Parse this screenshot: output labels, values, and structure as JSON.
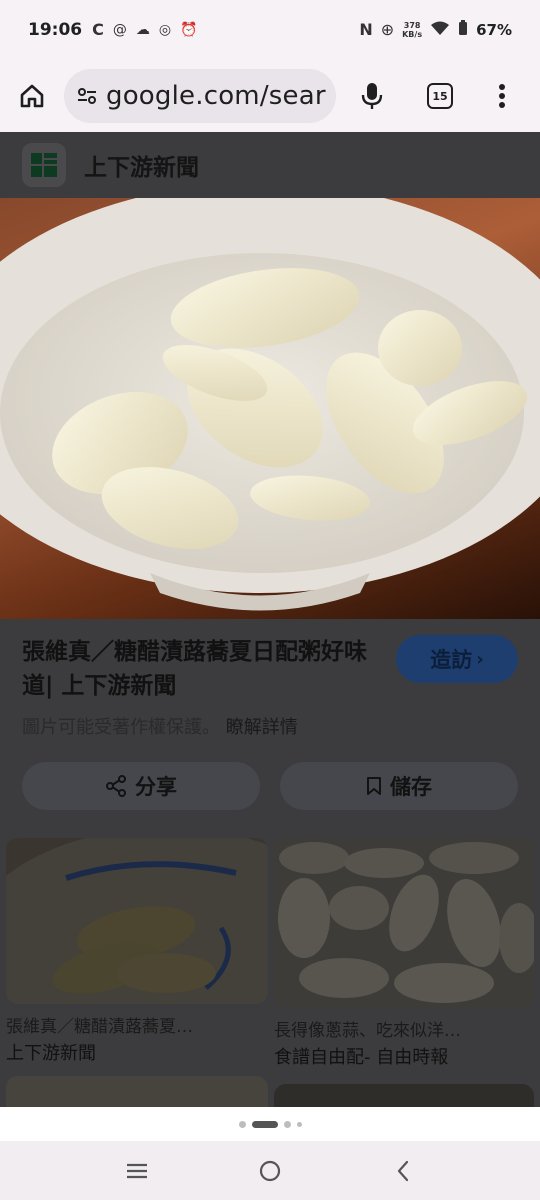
{
  "status_bar": {
    "time": "19:06",
    "network_speed_value": "378",
    "network_speed_unit": "KB/s",
    "battery_percent": "67%"
  },
  "toolbar": {
    "url": "google.com/sear",
    "tab_count": "15"
  },
  "viewer": {
    "source_name": "上下游新聞",
    "title": "張維真／糖醋漬蕗蕎夏日配粥好味道| 上下游新聞",
    "visit_label": "造訪",
    "copyright_text": "圖片可能受著作權保護。",
    "learn_more": "瞭解詳情",
    "share_label": "分享",
    "save_label": "儲存"
  },
  "related": [
    {
      "title": "張維真／糖醋漬蕗蕎夏…",
      "source": "上下游新聞"
    },
    {
      "title": "長得像蔥蒜、吃來似洋…",
      "source": "食譜自由配- 自由時報"
    }
  ],
  "colors": {
    "scrim": "#3c3c3e",
    "accent": "#1d3e6e"
  }
}
